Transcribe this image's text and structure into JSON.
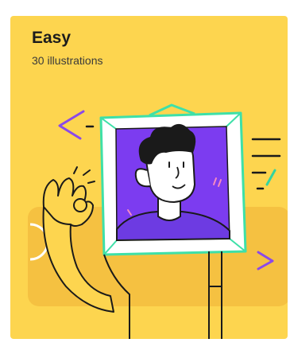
{
  "card": {
    "title": "Easy",
    "subtitle": "30 illustrations",
    "background_color": "#fdd54f",
    "accent_colors": {
      "frame_outline": "#3ee0a8",
      "portrait_background": "#7c3cf0",
      "shirt": "#6d3be2",
      "arrow_purple": "#8b49e8",
      "slash_green": "#34d4a0",
      "skin": "#ffffff",
      "hair": "#1a1a1a",
      "band_shade": "#f5c141"
    },
    "illustration": {
      "subject": "man-in-picture-frame-with-ok-hand-gesture",
      "icons": [
        "left-arrow-icon",
        "right-arrow-icon",
        "motion-lines-icon",
        "ok-hand-icon"
      ]
    }
  }
}
